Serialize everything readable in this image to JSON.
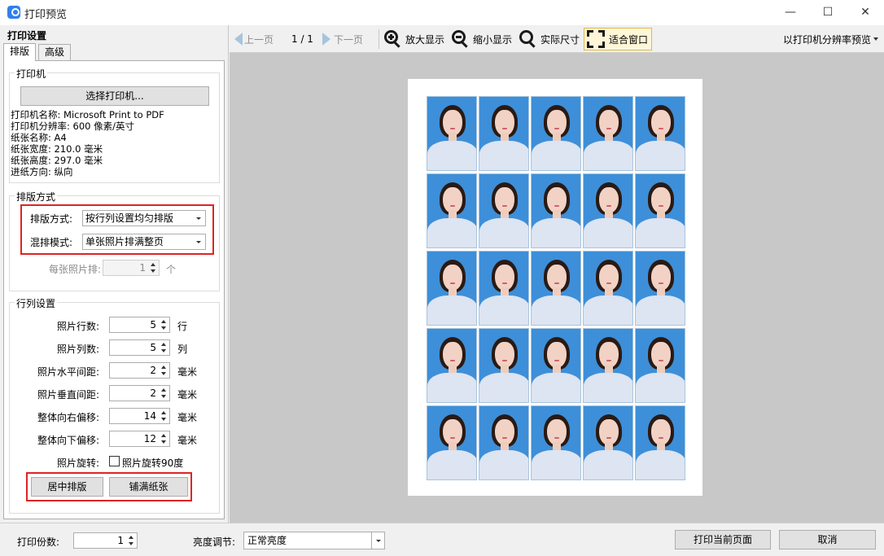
{
  "window": {
    "title": "打印预览",
    "minimize": "—",
    "maximize": "☐",
    "close": "✕"
  },
  "left_panel": {
    "title": "打印设置",
    "tabs": [
      {
        "label": "排版"
      },
      {
        "label": "高级"
      }
    ],
    "printer": {
      "legend": "打印机",
      "select_button": "选择打印机...",
      "info": [
        "打印机名称: Microsoft Print to PDF",
        "打印机分辨率: 600 像素/英寸",
        "纸张名称: A4",
        "纸张宽度: 210.0 毫米",
        "纸张高度: 297.0 毫米",
        "进纸方向: 纵向"
      ]
    },
    "layout": {
      "legend": "排版方式",
      "layout_mode_label": "排版方式:",
      "layout_mode_value": "按行列设置均匀排版",
      "mix_mode_label": "混排模式:",
      "mix_mode_value": "单张照片排满整页",
      "per_photo_label": "每张照片排:",
      "per_photo_value": "1",
      "per_photo_unit": "个"
    },
    "grid": {
      "legend": "行列设置",
      "fields": [
        {
          "label": "照片行数:",
          "value": "5",
          "unit": "行"
        },
        {
          "label": "照片列数:",
          "value": "5",
          "unit": "列"
        },
        {
          "label": "照片水平间距:",
          "value": "2",
          "unit": "毫米"
        },
        {
          "label": "照片垂直间距:",
          "value": "2",
          "unit": "毫米"
        },
        {
          "label": "整体向右偏移:",
          "value": "14",
          "unit": "毫米"
        },
        {
          "label": "整体向下偏移:",
          "value": "12",
          "unit": "毫米"
        }
      ],
      "rotate_label": "照片旋转:",
      "rotate_checkbox_label": "照片旋转90度",
      "rotate_checked": false,
      "center_button": "居中排版",
      "fill_button": "铺满纸张"
    }
  },
  "toolbar": {
    "prev_page": "上一页",
    "page_indicator": "1 / 1",
    "next_page": "下一页",
    "zoom_in": "放大显示",
    "zoom_out": "缩小显示",
    "actual_size": "实际尺寸",
    "fit_window": "适合窗口",
    "preview_mode": "以打印机分辨率预览"
  },
  "preview": {
    "rows": 5,
    "cols": 5,
    "background": "#3d8fd9"
  },
  "bottom": {
    "copies_label": "打印份数:",
    "copies_value": "1",
    "brightness_label": "亮度调节:",
    "brightness_value": "正常亮度",
    "print_button": "打印当前页面",
    "cancel_button": "取消"
  }
}
